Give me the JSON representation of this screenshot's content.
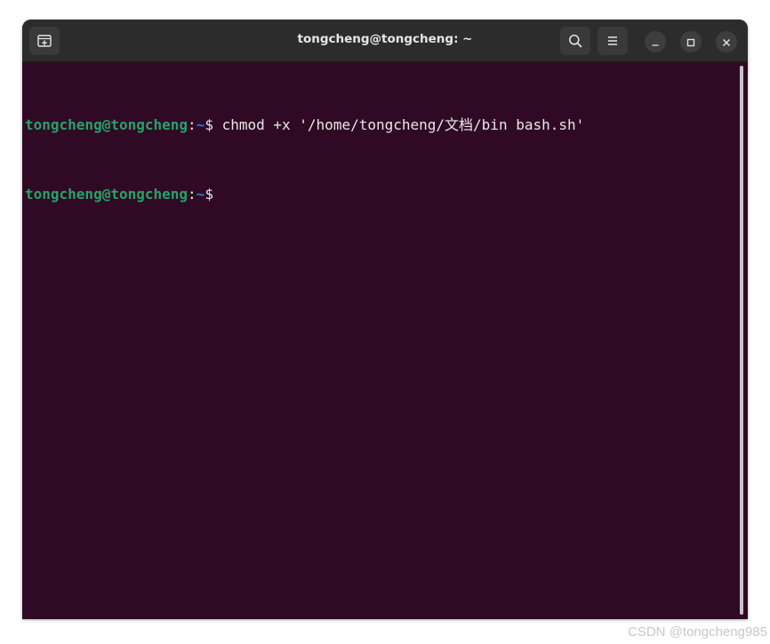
{
  "window": {
    "title": "tongcheng@tongcheng: ~"
  },
  "titlebar": {
    "new_tab_icon": "new-tab-icon",
    "search_icon": "search-icon",
    "menu_icon": "hamburger-menu-icon",
    "minimize_icon": "minimize-icon",
    "maximize_icon": "maximize-icon",
    "close_icon": "close-icon"
  },
  "terminal": {
    "lines": [
      {
        "user_host": "tongcheng@tongcheng",
        "colon": ":",
        "path": "~",
        "prompt": "$",
        "command": " chmod +x '/home/tongcheng/文档/bin bash.sh'"
      },
      {
        "user_host": "tongcheng@tongcheng",
        "colon": ":",
        "path": "~",
        "prompt": "$",
        "command": ""
      }
    ]
  },
  "colors": {
    "background": "#300a24",
    "user_host": "#26a269",
    "path": "#2a7bde",
    "text": "#e8e8e8",
    "titlebar": "#2c2c2c"
  },
  "watermark": "CSDN @tongcheng985"
}
